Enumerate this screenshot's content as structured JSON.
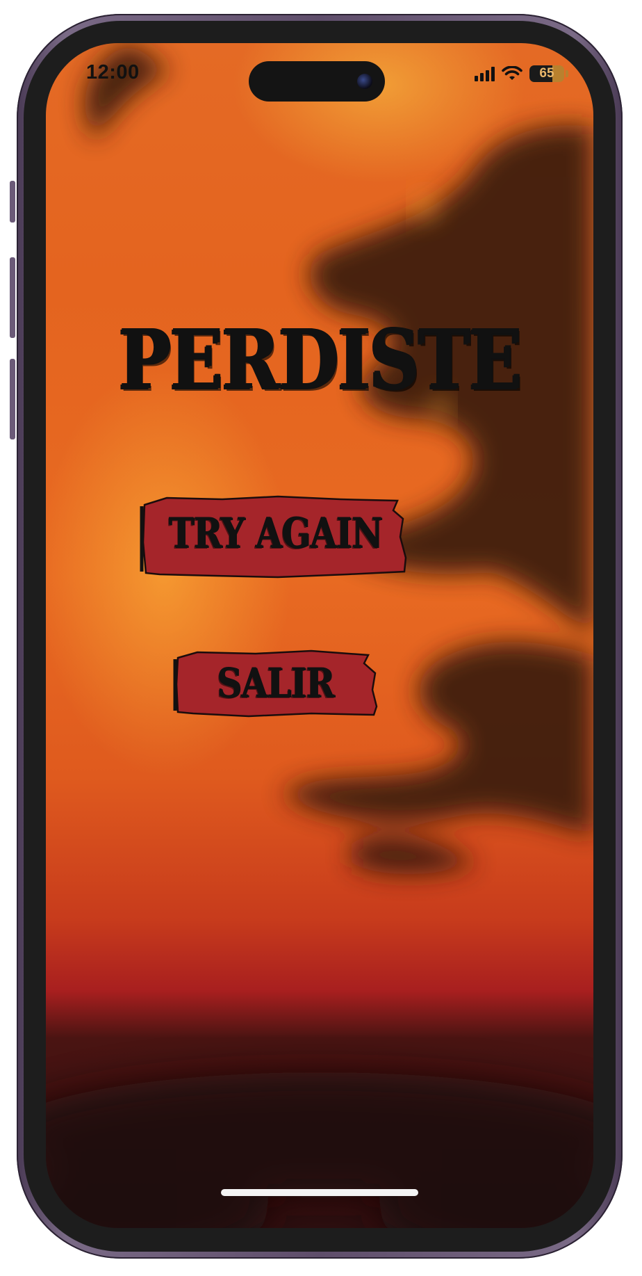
{
  "status_bar": {
    "time": "12:00",
    "battery_level": "65",
    "battery_fraction": 0.65
  },
  "screen": {
    "title": "PERDISTE",
    "buttons": [
      {
        "label": "TRY AGAIN"
      },
      {
        "label": "SALIR"
      }
    ]
  },
  "colors": {
    "button_red": "#a5252a",
    "background_orange": "#e4641f",
    "title_ink": "#111111"
  }
}
